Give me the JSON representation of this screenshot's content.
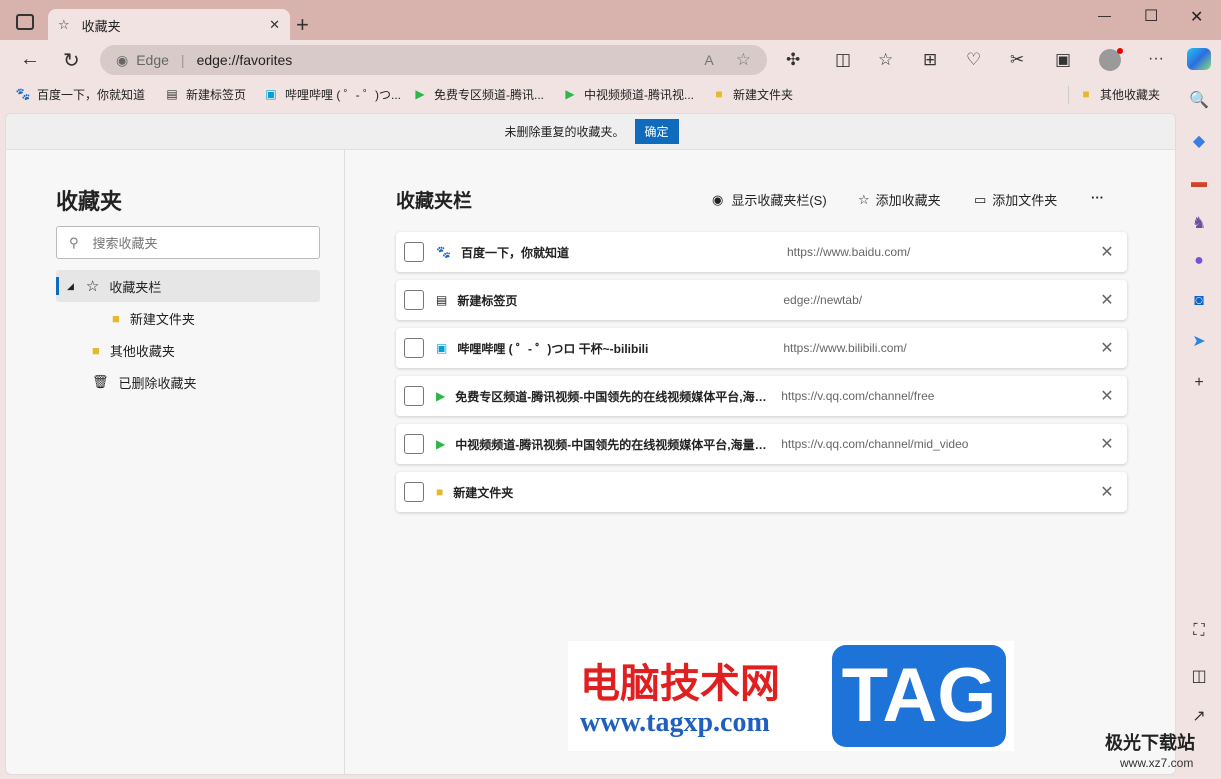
{
  "window": {
    "tab_title": "收藏夹",
    "minimize": "—",
    "maximize": "☐",
    "close": "✕",
    "new_tab": "+"
  },
  "address": {
    "brand": "Edge",
    "url": "edge://favorites"
  },
  "bookmarks_bar": [
    {
      "label": "百度一下，你就知道",
      "icon": "baidu-icon"
    },
    {
      "label": "新建标签页",
      "icon": "newtab-icon"
    },
    {
      "label": "哔哩哔哩 ( ゜- ゜)つ...",
      "icon": "bilibili-icon"
    },
    {
      "label": "免费专区频道-腾讯...",
      "icon": "tencent-video-icon"
    },
    {
      "label": "中视频频道-腾讯视...",
      "icon": "tencent-video-icon"
    },
    {
      "label": "新建文件夹",
      "icon": "folder-icon"
    }
  ],
  "other_favorites": "其他收藏夹",
  "notice": {
    "text": "未删除重复的收藏夹。",
    "button": "确定"
  },
  "left": {
    "title": "收藏夹",
    "search_placeholder": "搜索收藏夹",
    "tree": [
      {
        "label": "收藏夹栏"
      },
      {
        "label": "新建文件夹"
      },
      {
        "label": "其他收藏夹"
      },
      {
        "label": "已删除收藏夹"
      }
    ]
  },
  "main": {
    "title": "收藏夹栏",
    "actions": {
      "show_bar": "显示收藏夹栏(S)",
      "add_favorite": "添加收藏夹",
      "add_folder": "添加文件夹",
      "more": "···"
    },
    "items": [
      {
        "title": "百度一下，你就知道",
        "url": "https://www.baidu.com/"
      },
      {
        "title": "新建标签页",
        "url": "edge://newtab/"
      },
      {
        "title": "哔哩哔哩 ( ゜- ゜)つロ 干杯~-bilibili",
        "url": "https://www.bilibili.com/"
      },
      {
        "title": "免费专区频道-腾讯视频-中国领先的在线视频媒体平台,海量高清视频在线观看",
        "url": "https://v.qq.com/channel/free"
      },
      {
        "title": "中视频频道-腾讯视频-中国领先的在线视频媒体平台,海量高清视频在线观看",
        "url": "https://v.qq.com/channel/mid_video"
      },
      {
        "title": "新建文件夹",
        "url": ""
      }
    ]
  },
  "watermark": {
    "cn": "电脑技术网",
    "url": "www.tagxp.com",
    "tag": "TAG",
    "site2": "极光下载站",
    "url2": "www.xz7.com"
  }
}
